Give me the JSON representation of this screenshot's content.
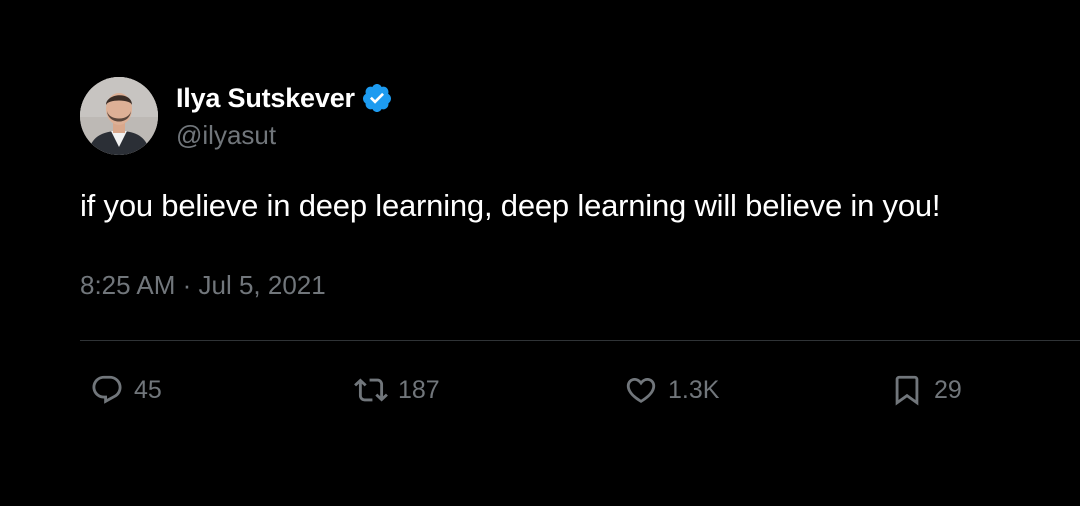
{
  "author": {
    "display_name": "Ilya Sutskever",
    "handle": "@ilyasut",
    "verified": true,
    "avatar": "avatar-photo"
  },
  "tweet": {
    "text": "if you believe in deep learning, deep learning will believe in you!",
    "timestamp": "8:25 AM · Jul 5, 2021"
  },
  "actions": {
    "reply": {
      "icon": "reply-icon",
      "count": "45"
    },
    "retweet": {
      "icon": "retweet-icon",
      "count": "187"
    },
    "like": {
      "icon": "heart-icon",
      "count": "1.3K"
    },
    "bookmark": {
      "icon": "bookmark-icon",
      "count": "29"
    }
  },
  "colors": {
    "background": "#000000",
    "text_primary": "#ffffff",
    "text_secondary": "#71767b",
    "verified_blue": "#1d9bf0",
    "divider": "#2f3336"
  }
}
